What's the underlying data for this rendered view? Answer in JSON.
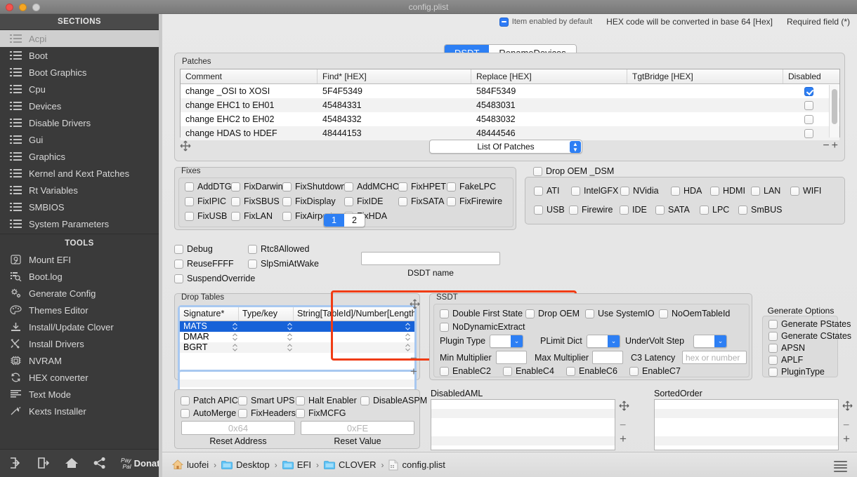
{
  "window": {
    "title": "config.plist",
    "traffic_lights": [
      "close",
      "minimize",
      "zoom"
    ]
  },
  "sidebar": {
    "sections_header": "SECTIONS",
    "tools_header": "TOOLS",
    "sections": [
      {
        "label": "Acpi",
        "icon": "list-icon",
        "selected": true
      },
      {
        "label": "Boot",
        "icon": "list-icon",
        "selected": false
      },
      {
        "label": "Boot Graphics",
        "icon": "list-icon",
        "selected": false
      },
      {
        "label": "Cpu",
        "icon": "list-icon",
        "selected": false
      },
      {
        "label": "Devices",
        "icon": "list-icon",
        "selected": false
      },
      {
        "label": "Disable Drivers",
        "icon": "list-icon",
        "selected": false
      },
      {
        "label": "Gui",
        "icon": "list-icon",
        "selected": false
      },
      {
        "label": "Graphics",
        "icon": "list-icon",
        "selected": false
      },
      {
        "label": "Kernel and Kext Patches",
        "icon": "list-icon",
        "selected": false
      },
      {
        "label": "Rt Variables",
        "icon": "list-icon",
        "selected": false
      },
      {
        "label": "SMBIOS",
        "icon": "list-icon",
        "selected": false
      },
      {
        "label": "System Parameters",
        "icon": "list-icon",
        "selected": false
      }
    ],
    "tools": [
      {
        "label": "Mount EFI",
        "icon": "disk-icon"
      },
      {
        "label": "Boot.log",
        "icon": "log-search-icon"
      },
      {
        "label": "Generate Config",
        "icon": "gears-icon"
      },
      {
        "label": "Themes Editor",
        "icon": "palette-icon"
      },
      {
        "label": "Install/Update Clover",
        "icon": "download-icon"
      },
      {
        "label": "Install Drivers",
        "icon": "tools-icon"
      },
      {
        "label": "NVRAM",
        "icon": "chip-icon"
      },
      {
        "label": "HEX converter",
        "icon": "refresh-icon"
      },
      {
        "label": "Text Mode",
        "icon": "text-lines-icon"
      },
      {
        "label": "Kexts Installer",
        "icon": "plug-icon"
      }
    ],
    "footer": {
      "icons": [
        "import-icon",
        "export-icon",
        "home-icon",
        "share-icon"
      ],
      "paypal_line1": "Pay",
      "paypal_line2": "Pal",
      "donate_label": "Donate"
    }
  },
  "header": {
    "item_enabled_note": "Item enabled by default",
    "hex_note": "HEX code will be converted in base 64 [Hex]",
    "required_note": "Required field (*)",
    "tabs": [
      {
        "label": "DSDT",
        "active": true
      },
      {
        "label": "RenameDevices",
        "active": false
      }
    ]
  },
  "patches": {
    "title": "Patches",
    "columns": [
      "Comment",
      "Find* [HEX]",
      "Replace [HEX]",
      "TgtBridge [HEX]",
      "Disabled"
    ],
    "rows": [
      {
        "comment": "change _OSI to XOSI",
        "find": "5F4F5349",
        "replace": "584F5349",
        "tgtbridge": "",
        "disabled": true
      },
      {
        "comment": "change EHC1 to EH01",
        "find": "45484331",
        "replace": "45483031",
        "tgtbridge": "",
        "disabled": false
      },
      {
        "comment": "change EHC2 to EH02",
        "find": "45484332",
        "replace": "45483032",
        "tgtbridge": "",
        "disabled": false
      },
      {
        "comment": "change HDAS to HDEF",
        "find": "48444153",
        "replace": "48444546",
        "tgtbridge": "",
        "disabled": false
      }
    ],
    "popup_value": "List Of Patches",
    "remove_label": "−",
    "add_label": "+"
  },
  "fixes": {
    "title": "Fixes",
    "rows": [
      [
        {
          "label": "AddDTGP",
          "checked": false
        },
        {
          "label": "FixDarwin",
          "checked": false
        },
        {
          "label": "FixShutdown",
          "checked": false
        },
        {
          "label": "AddMCHC",
          "checked": false
        },
        {
          "label": "FixHPET",
          "checked": false
        },
        {
          "label": "FakeLPC",
          "checked": false
        }
      ],
      [
        {
          "label": "FixIPIC",
          "checked": false
        },
        {
          "label": "FixSBUS",
          "checked": false
        },
        {
          "label": "FixDisplay",
          "checked": false
        },
        {
          "label": "FixIDE",
          "checked": false
        },
        {
          "label": "FixSATA",
          "checked": false
        },
        {
          "label": "FixFirewire",
          "checked": false
        }
      ],
      [
        {
          "label": "FixUSB",
          "checked": false
        },
        {
          "label": "FixLAN",
          "checked": false
        },
        {
          "label": "FixAirport",
          "checked": false
        },
        {
          "label": "FixHDA",
          "checked": false
        }
      ]
    ],
    "pages": [
      {
        "label": "1",
        "active": true
      },
      {
        "label": "2",
        "active": false
      }
    ]
  },
  "drop_oem_dsm": {
    "header_label": "Drop OEM _DSM",
    "header_checked": false,
    "rows": [
      [
        {
          "label": "ATI",
          "checked": false
        },
        {
          "label": "IntelGFX",
          "checked": false
        },
        {
          "label": "NVidia",
          "checked": false
        },
        {
          "label": "HDA",
          "checked": false
        },
        {
          "label": "HDMI",
          "checked": false
        },
        {
          "label": "LAN",
          "checked": false
        },
        {
          "label": "WIFI",
          "checked": false
        }
      ],
      [
        {
          "label": "USB",
          "checked": false
        },
        {
          "label": "Firewire",
          "checked": false
        },
        {
          "label": "IDE",
          "checked": false
        },
        {
          "label": "SATA",
          "checked": false
        },
        {
          "label": "LPC",
          "checked": false
        },
        {
          "label": "SmBUS",
          "checked": false
        }
      ]
    ]
  },
  "debug_group": {
    "items": [
      {
        "label": "Debug",
        "checked": false
      },
      {
        "label": "Rtc8Allowed",
        "checked": false
      },
      {
        "label": "ReuseFFFF",
        "checked": false
      },
      {
        "label": "SlpSmiAtWake",
        "checked": false
      },
      {
        "label": "SuspendOverride",
        "checked": false
      }
    ],
    "dsdt_name_value": "",
    "dsdt_name_label": "DSDT name"
  },
  "drop_tables": {
    "title": "Drop Tables",
    "columns": [
      "Signature*",
      "Type/key",
      "String[TableId]/Number[Length]"
    ],
    "rows": [
      {
        "signature": "MATS",
        "typekey": "",
        "value": "",
        "selected": true
      },
      {
        "signature": "DMAR",
        "typekey": "",
        "value": "",
        "selected": false
      },
      {
        "signature": "BGRT",
        "typekey": "",
        "value": "",
        "selected": false
      }
    ],
    "highlight_color": "#f03c14"
  },
  "ssdt": {
    "title": "SSDT",
    "checks_row1": [
      {
        "label": "Double First State",
        "checked": false
      },
      {
        "label": "Drop OEM",
        "checked": false
      },
      {
        "label": "Use SystemIO",
        "checked": false
      },
      {
        "label": "NoOemTableId",
        "checked": false
      }
    ],
    "checks_row2": [
      {
        "label": "NoDynamicExtract",
        "checked": false
      }
    ],
    "plugin_type_label": "Plugin Type",
    "plugin_type_value": "",
    "plimit_dict_label": "PLimit Dict",
    "plimit_dict_value": "",
    "undervolt_step_label": "UnderVolt Step",
    "undervolt_step_value": "",
    "min_multiplier_label": "Min Multiplier",
    "min_multiplier_value": "",
    "max_multiplier_label": "Max Multiplier",
    "max_multiplier_value": "",
    "c3_latency_label": "C3 Latency",
    "c3_latency_placeholder": "hex or number",
    "enable_c": [
      {
        "label": "EnableC2",
        "checked": false
      },
      {
        "label": "EnableC4",
        "checked": false
      },
      {
        "label": "EnableC6",
        "checked": false
      },
      {
        "label": "EnableC7",
        "checked": false
      }
    ]
  },
  "generate_options": {
    "title": "Generate Options",
    "items": [
      {
        "label": "Generate PStates",
        "checked": false
      },
      {
        "label": "Generate CStates",
        "checked": false
      },
      {
        "label": "APSN",
        "checked": false
      },
      {
        "label": "APLF",
        "checked": false
      },
      {
        "label": "PluginType",
        "checked": false
      }
    ]
  },
  "apic": {
    "row1": [
      {
        "label": "Patch APIC",
        "checked": false
      },
      {
        "label": "Smart UPS",
        "checked": false
      },
      {
        "label": "Halt Enabler",
        "checked": false
      },
      {
        "label": "DisableASPM",
        "checked": false
      }
    ],
    "row2": [
      {
        "label": "AutoMerge",
        "checked": false
      },
      {
        "label": "FixHeaders",
        "checked": false
      },
      {
        "label": "FixMCFG",
        "checked": false
      }
    ],
    "reset_address_placeholder": "0x64",
    "reset_address_label": "Reset Address",
    "reset_value_placeholder": "0xFE",
    "reset_value_label": "Reset Value"
  },
  "lists": {
    "disabled_aml_title": "DisabledAML",
    "disabled_aml_items": [],
    "sorted_order_title": "SortedOrder",
    "sorted_order_items": [],
    "remove_label": "−",
    "add_label": "+"
  },
  "breadcrumb": {
    "items": [
      {
        "label": "luofei",
        "icon": "home-icon"
      },
      {
        "label": "Desktop",
        "icon": "folder-icon"
      },
      {
        "label": "EFI",
        "icon": "folder-icon"
      },
      {
        "label": "CLOVER",
        "icon": "folder-icon"
      },
      {
        "label": "config.plist",
        "icon": "file-icon"
      }
    ],
    "separator": "›",
    "menu_icon": "hamburger-icon"
  },
  "colors": {
    "accent": "#2d7ff4",
    "selection": "#1762d8",
    "highlight": "#f03c14",
    "sidebar_bg": "#3a3a3a"
  }
}
